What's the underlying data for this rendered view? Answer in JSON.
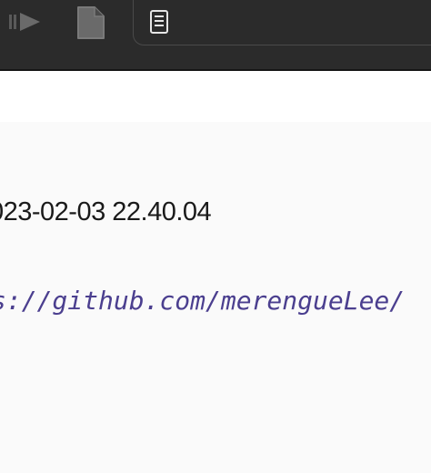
{
  "toolbar": {
    "media_icon": "play-forward-icon",
    "page_icon": "document-icon",
    "reader_icon": "reader-mode-icon"
  },
  "content": {
    "timestamp": "023-02-03 22.40.04",
    "link_text": "s://github.com/merengueLee/"
  },
  "colors": {
    "toolbar_bg": "#2b2b2b",
    "content_bg": "#fafafa",
    "link": "#4b3f8f"
  }
}
